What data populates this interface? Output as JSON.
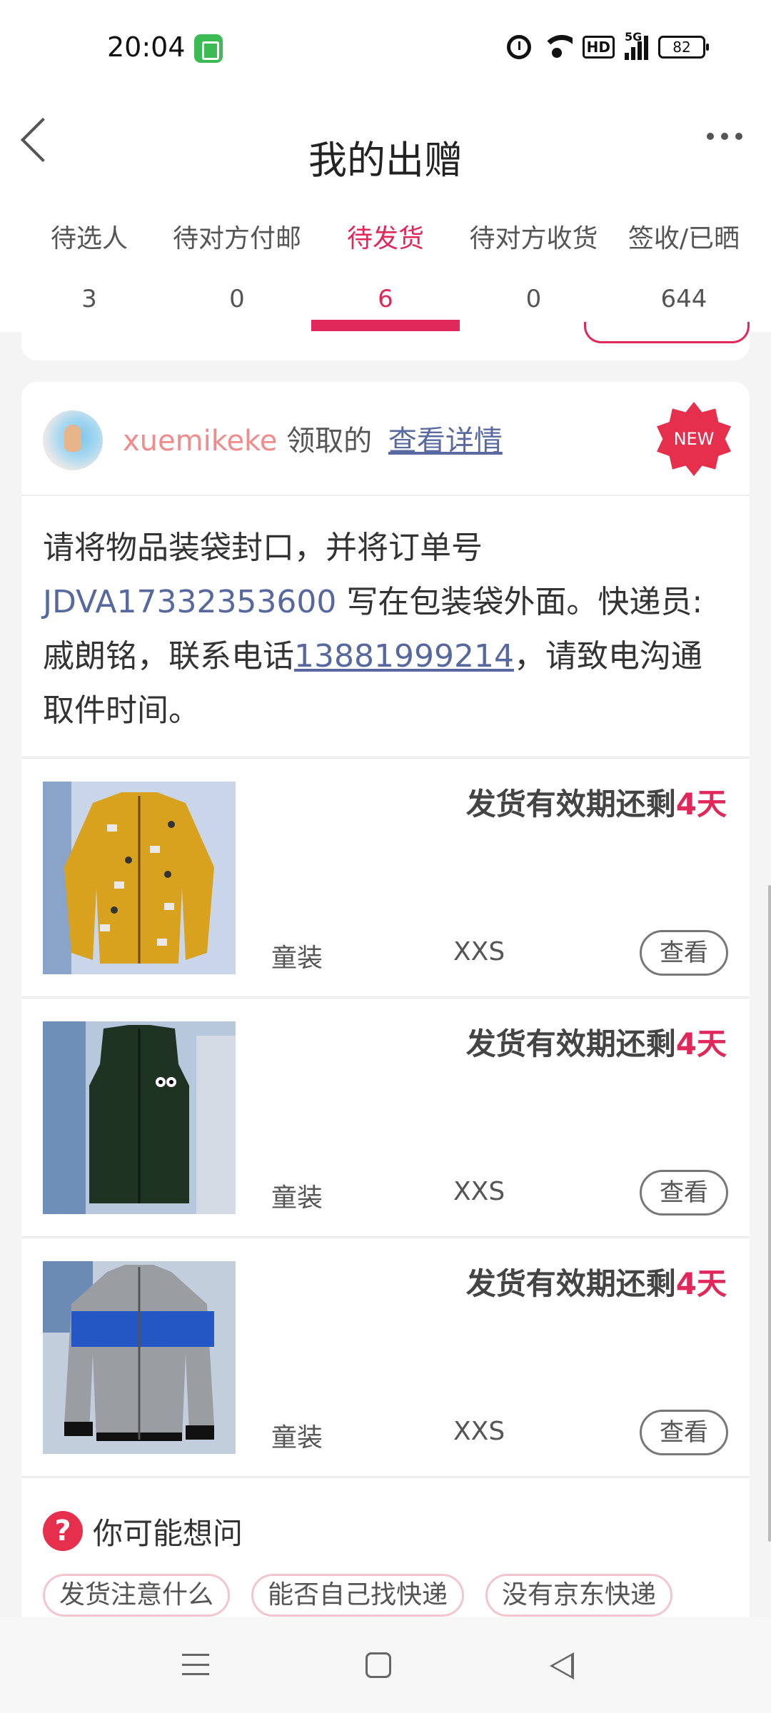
{
  "status_bar": {
    "time": "20:04",
    "hd": "HD",
    "network": "5G",
    "battery": "82",
    "icons": [
      "app-notification-icon",
      "alarm-icon",
      "wifi-icon",
      "hd-icon",
      "signal-icon",
      "battery-icon"
    ]
  },
  "header": {
    "title": "我的出赠",
    "back_icon": "back-chevron-icon",
    "more_icon": "more-dots-icon"
  },
  "tabs": [
    {
      "label": "待选人",
      "count": "3"
    },
    {
      "label": "待对方付邮",
      "count": "0"
    },
    {
      "label": "待发货",
      "count": "6",
      "active": true
    },
    {
      "label": "待对方收货",
      "count": "0"
    },
    {
      "label": "签收/已晒",
      "count": "644"
    }
  ],
  "colors": {
    "accent": "#e0285a",
    "link": "#56689e",
    "username": "#f08c8c",
    "badge": "#e62e4d"
  },
  "card": {
    "username": "xuemikeke",
    "claim_text": "领取的",
    "detail_link": "查看详情",
    "badge": "NEW",
    "instruction": {
      "part1": "请将物品装袋封口，并将订单号 ",
      "order_no": "JDVA17332353600",
      "part2": " 写在包装袋外面。快递员:戚朗铭，联系电话",
      "phone": "13881999214",
      "part3": "，请致电沟通取件时间。"
    },
    "items": [
      {
        "deadline_prefix": "发货有效期还剩",
        "days": "4天",
        "category": "童装",
        "size": "XXS",
        "view": "查看",
        "image": "yellow-jacket"
      },
      {
        "deadline_prefix": "发货有效期还剩",
        "days": "4天",
        "category": "童装",
        "size": "XXS",
        "view": "查看",
        "image": "green-vest"
      },
      {
        "deadline_prefix": "发货有效期还剩",
        "days": "4天",
        "category": "童装",
        "size": "XXS",
        "view": "查看",
        "image": "grey-hoodie"
      }
    ]
  },
  "faq": {
    "title": "你可能想问",
    "chips": [
      "发货注意什么",
      "能否自己找快递",
      "没有京东快递"
    ]
  },
  "nav_bar": {
    "icons": [
      "menu-icon",
      "home-icon",
      "back-triangle-icon"
    ]
  }
}
